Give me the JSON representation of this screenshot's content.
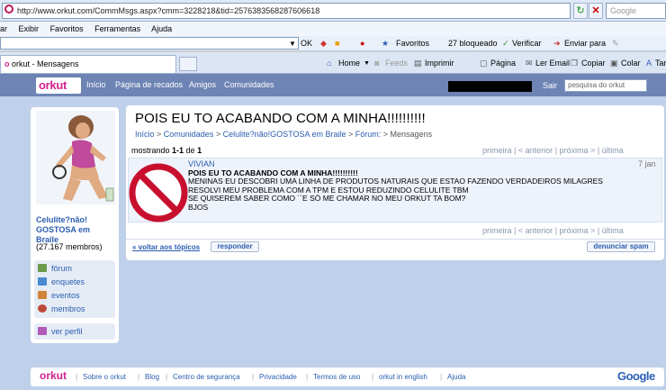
{
  "browser": {
    "url": "http://www.orkut.com/CommMsgs.aspx?cmm=3228218&tid=2576383568287606618",
    "search_placeholder": "Google",
    "menu": [
      "ar",
      "Exibir",
      "Favoritos",
      "Ferramentas",
      "Ajuda"
    ],
    "toolbar": {
      "ok": "OK",
      "favoritos": "Favoritos",
      "bloqueado": "27 bloqueado",
      "verificar": "Verificar",
      "enviar": "Enviar para"
    },
    "tab_title": "orkut - Mensagens",
    "commands": {
      "home": "Home",
      "feeds": "Feeds",
      "imprimir": "Imprimir",
      "pagina": "Página",
      "ler_email": "Ler Email",
      "copiar": "Copiar",
      "colar": "Colar",
      "tar": "Tar"
    }
  },
  "orkut": {
    "logo": "orkut",
    "nav": [
      "Início",
      "Página de recados",
      "Amigos",
      "Comunidades"
    ],
    "sair": "Sair",
    "search_placeholder": "pesquisa do orkut"
  },
  "community": {
    "name": "Celulite?não! GOSTOSA em Braile",
    "members": "(27.167 membros)",
    "menu": [
      "fórum",
      "enquetes",
      "eventos",
      "membros"
    ],
    "ver_perfil": "ver perfil"
  },
  "topic": {
    "title": "POIS EU TO ACABANDO COM A MINHA!!!!!!!!!!",
    "breadcrumb": {
      "inicio": "Início",
      "sep1": " > ",
      "comunidades": "Comunidades",
      "sep2": " > ",
      "community": "Celulite?não!GOSTOSA em Braile",
      "sep3": " > ",
      "forum": "Fórum:",
      "sep4": " > ",
      "mensagens": "Mensagens"
    },
    "showing_prefix": "mostrando ",
    "showing_range": "1-1",
    "showing_de": " de ",
    "showing_total": "1",
    "pager": {
      "primeira": "primeira",
      "anterior": "< anterior",
      "proxima": "próxima >",
      "ultima": "última",
      "sep": "|"
    },
    "post": {
      "author": "VIVIAN",
      "date": "7 jan",
      "title": "POIS EU TO ACABANDO COM A MINHA!!!!!!!!!!",
      "body": "MENINAS EU DESCOBRI UMA LINHA DE PRODUTOS NATURAIS QUE ESTAO FAZENDO VERDADEIROS MILAGRES\nRESOLVI MEU PROBLEMA COM A TPM E ESTOU REDUZINDO CELULITE TBM\nSE QUISEREM SABER COMO ´´E SÓ ME CHAMAR NO MEU ORKUT TA BOM?\nBJOS"
    },
    "back_link": "« voltar aos tópicos",
    "reply_button": "responder",
    "spam_button": "denunciar spam"
  },
  "footer": {
    "logo": "orkut",
    "links": [
      "Sobre o orkut",
      "Blog",
      "Centro de segurança",
      "Privacidade",
      "Termos de uso",
      "orkut in english",
      "Ajuda"
    ],
    "google": "Google"
  },
  "colors": {
    "orkut_nav": "#6d84b4",
    "orkut_bg": "#bfd0ea",
    "link": "#2a5db0",
    "orkut_pink": "#d1228e"
  }
}
